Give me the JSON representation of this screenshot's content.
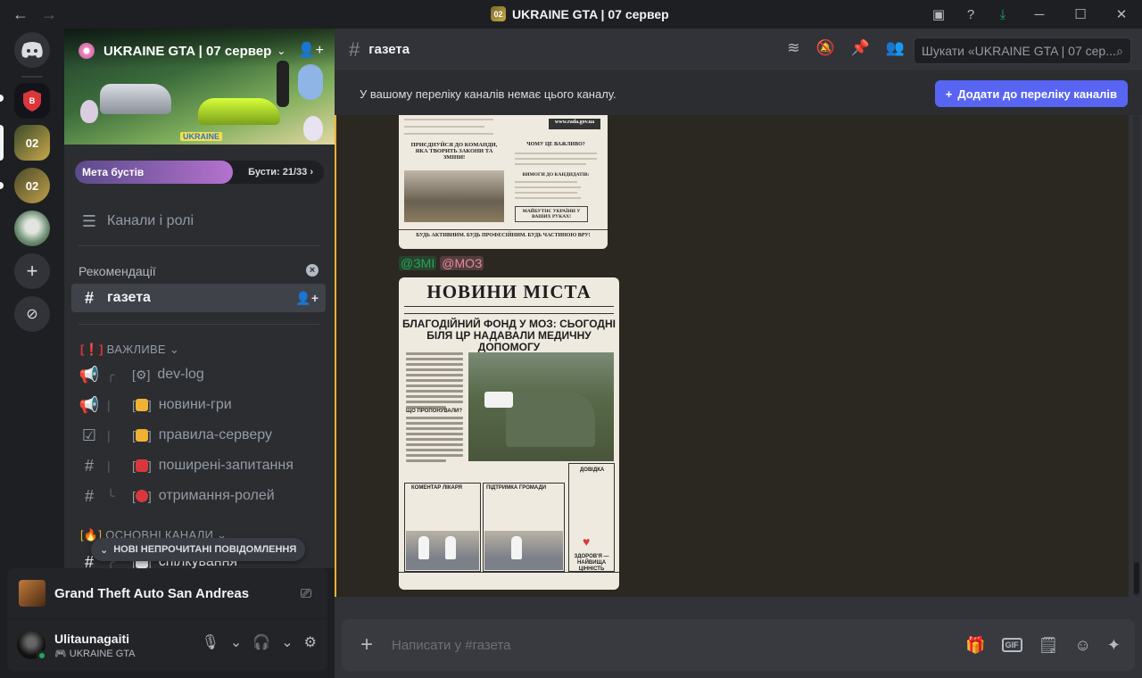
{
  "titlebar": {
    "back": "←",
    "forward": "→",
    "title": "UKRAINE GTA | 07 сервер",
    "server_badge": "02"
  },
  "rail": {
    "servers": [
      {
        "name": "VARTA",
        "label": "ВАРТА",
        "color": "#12141a"
      },
      {
        "name": "UKRAINE GTA 07",
        "label": "02",
        "color": "#6b5a1f",
        "selected": true,
        "voice": true
      },
      {
        "name": "UKRAINE GTA 02",
        "label": "02",
        "color": "#5f5120"
      },
      {
        "name": "Avatar server",
        "label": "",
        "color": "#4d6b52"
      }
    ]
  },
  "sidebar": {
    "server_name": "UKRAINE GTA | 07 сервер",
    "banner_logo": "UKRAINE",
    "boost": {
      "goal": "Мета бустів",
      "count": "Бусти: 21/33",
      "progress": 0.636
    },
    "channels_roles": "Канали і ролі",
    "recommendations": "Рекомендації",
    "active_channel": "газета",
    "categories": [
      {
        "label": "ВАЖЛИВЕ",
        "marker": "[❗]"
      },
      {
        "label": "ОСНОВНІ КАНАЛИ",
        "marker": "[🔥]"
      }
    ],
    "channels": [
      {
        "tree": "╭",
        "box": "[⚙]",
        "name": "dev-log",
        "icon": "announce",
        "emoji_color": ""
      },
      {
        "tree": "|",
        "box": "[",
        "name": "новини-гри",
        "icon": "announce",
        "emoji_color": "#f0b232"
      },
      {
        "tree": "|",
        "box": "[",
        "name": "правила-серверу",
        "icon": "rules",
        "emoji_color": "#f0b232"
      },
      {
        "tree": "|",
        "box": "[",
        "name": "поширені-запитання",
        "icon": "hash",
        "emoji_color": "#da373c"
      },
      {
        "tree": "╰",
        "box": "[",
        "name": "отримання-ролей",
        "icon": "hash",
        "emoji_color": "#da373c"
      },
      {
        "tree": "╭",
        "box": "[",
        "name": "спілкування",
        "icon": "hash",
        "emoji_color": "#dbdee1"
      }
    ],
    "unread_pill": "НОВІ НЕПРОЧИТАНІ ПОВІДОМЛЕННЯ"
  },
  "activity": {
    "game": "Grand Theft Auto San Andreas"
  },
  "user": {
    "name": "Ulitaunagaiti",
    "status": "UKRAINE GTA"
  },
  "channel_header": {
    "name": "газета",
    "search_placeholder": "Шукати «UKRAINE GTA | 07 сер..."
  },
  "notice": {
    "text": "У вашому переліку каналів немає цього каналу.",
    "button": "Додати до переліку каналів"
  },
  "messages": {
    "newspaper1": {
      "join_title": "ПРИЄДНУЙСЯ ДО КОМАНДИ, ЯКА ТВОРИТЬ ЗАКОНИ ТА ЗМІНИ!",
      "why_title": "ЧОМУ ЦЕ ВАЖЛИВО?",
      "req_title": "ВИМОГИ ДО КАНДИДАТІВ:",
      "find_title": "МАЙБУТНЄ УКРАЇНИ У ВАШИХ РУКАХ!",
      "footer": "БУДЬ АКТИВНИМ. БУДЬ ПРОФЕСІЙНИМ. БУДЬ ЧАСТИНОЮ ВРУ!",
      "site": "www.rada.gov.ua"
    },
    "mentions": [
      "@ЗМІ",
      "@МОЗ"
    ],
    "newspaper2": {
      "masthead": "НОВИНИ МІСТА",
      "headline": "БЛАГОДІЙНИЙ ФОНД У МОЗ: СЬОГОДНІ БІЛЯ ЦР НАДАВАЛИ МЕДИЧНУ ДОПОМОГУ",
      "offered": "ЩО ПРОПОНУВАЛИ?",
      "comment": "КОМЕНТАР ЛІКАРЯ",
      "support": "ПІДТРИМКА ГРОМАДИ",
      "info": "ДОВІДКА",
      "health": "ЗДОРОВ'Я — НАЙВИЩА ЦІННІСТЬ"
    }
  },
  "composer": {
    "placeholder": "Написати у #газета",
    "gif": "GIF"
  }
}
